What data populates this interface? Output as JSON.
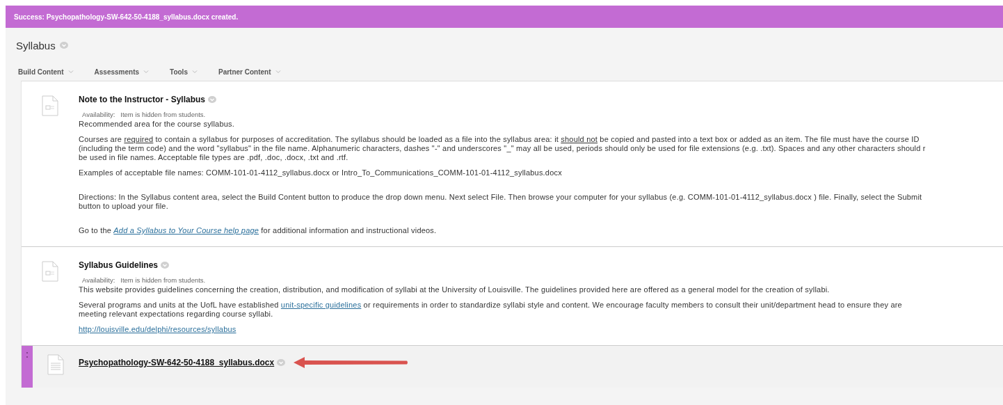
{
  "banner": {
    "text": "Success: Psychopathology-SW-642-50-4188_syllabus.docx created."
  },
  "page_title": "Syllabus",
  "menu": [
    {
      "label": "Build Content"
    },
    {
      "label": "Assessments"
    },
    {
      "label": "Tools"
    },
    {
      "label": "Partner Content"
    }
  ],
  "items": [
    {
      "title": "Note to the Instructor - Syllabus",
      "kind": "note",
      "availability_label": "Availability:",
      "availability": "Item is hidden from students.",
      "paragraphs": [
        [
          [
            {
              "kind": "text",
              "text": "Recommended area for the course syllabus."
            }
          ]
        ],
        [
          [
            {
              "kind": "text",
              "text": "Courses are "
            },
            {
              "kind": "underline",
              "text": "required"
            },
            {
              "kind": "text",
              "text": " to contain a syllabus for purposes of accreditation. The syllabus should be loaded as a file into the syllabus area: it "
            },
            {
              "kind": "underline",
              "text": "should not"
            },
            {
              "kind": "text",
              "text": " be copied and pasted into a text box or added as an item. The file must have the course ID"
            }
          ],
          [
            {
              "kind": "text",
              "text": "(including the term code) and the word \"syllabus\" in the file name. Alphanumeric characters, dashes \"-\" and underscores \"_\" may all be used, periods should only be used for file extensions (e.g. .txt). Spaces and any other characters should r"
            }
          ],
          [
            {
              "kind": "text",
              "text": "be used in file names. Acceptable file types are .pdf, .doc, .docx, .txt and .rtf."
            }
          ]
        ],
        [
          [
            {
              "kind": "text",
              "text": "Examples of acceptable file names: COMM-101-01-4112_syllabus.docx or Intro_To_Communications_COMM-101-01-4112_syllabus.docx"
            }
          ]
        ],
        [
          [
            {
              "kind": "text",
              "text": "Directions: In the Syllabus content area, select the Build Content button to produce the drop down menu. Next select File. Then browse your computer for your syllabus (e.g. COMM-101-01-4112_syllabus.docx ) file. Finally, select the Submit"
            }
          ],
          [
            {
              "kind": "text",
              "text": "button to upload your file."
            }
          ]
        ],
        [
          [
            {
              "kind": "text",
              "text": "Go to the "
            },
            {
              "kind": "italic-link",
              "text": "Add a Syllabus to Your Course help page"
            },
            {
              "kind": "text",
              "text": " for additional information and instructional videos."
            }
          ]
        ]
      ]
    },
    {
      "title": "Syllabus Guidelines",
      "kind": "note",
      "availability_label": "Availability:",
      "availability": "Item is hidden from students.",
      "paragraphs": [
        [
          [
            {
              "kind": "text",
              "text": "This website provides guidelines concerning the creation, distribution, and modification of syllabi at the University of Louisville. The guidelines provided here are offered as a general model for the creation of syllabi."
            }
          ]
        ],
        [
          [
            {
              "kind": "text",
              "text": "Several programs and units at the UofL have established "
            },
            {
              "kind": "link",
              "text": "unit-specific guidelines"
            },
            {
              "kind": "text",
              "text": " or requirements in order to standardize syllabi style and content. We encourage faculty members to consult their unit/department head to ensure they are"
            }
          ],
          [
            {
              "kind": "text",
              "text": "meeting relevant expectations regarding course syllabi."
            }
          ]
        ],
        [
          [
            {
              "kind": "link",
              "text": "http://louisville.edu/delphi/resources/syllabus"
            }
          ]
        ]
      ]
    },
    {
      "title": "Psychopathology-SW-642-50-4188_syllabus.docx",
      "kind": "file",
      "selected": true
    }
  ]
}
